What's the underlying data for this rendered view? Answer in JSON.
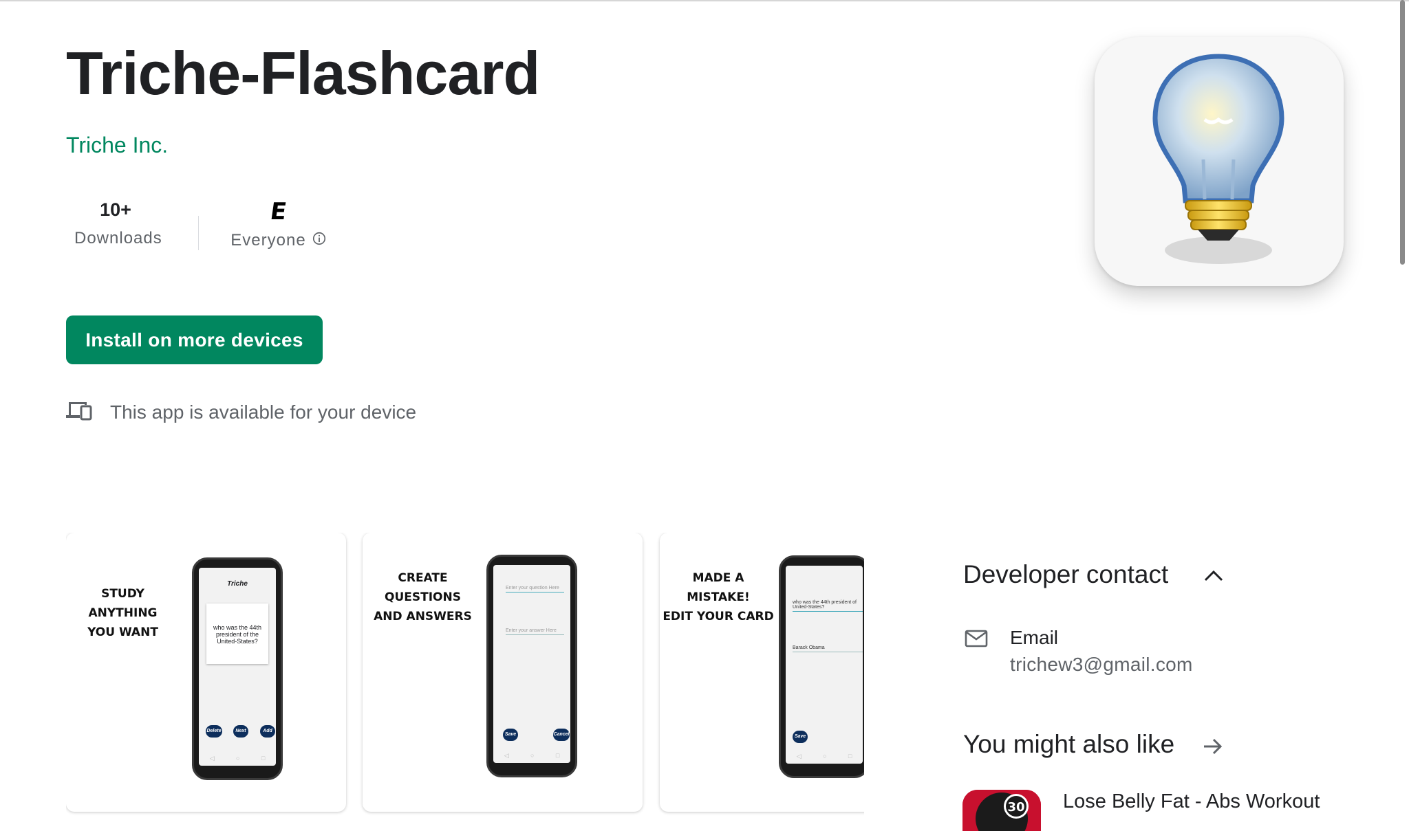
{
  "app": {
    "title": "Triche-Flashcard",
    "developer": "Triche Inc."
  },
  "stats": {
    "downloads_value": "10+",
    "downloads_label": "Downloads",
    "rating_symbol": "E",
    "rating_label": "Everyone"
  },
  "install_button": "Install on more devices",
  "device_availability": "This app is available for your device",
  "screenshots": [
    {
      "caption_line1": "STUDY ANYTHING",
      "caption_line2": "YOU WANT",
      "app_name": "Triche",
      "question": "who was the 44th president of the United-States?",
      "buttons": [
        "Delete",
        "Next",
        "Add"
      ]
    },
    {
      "caption_line1": "CREATE QUESTIONS",
      "caption_line2": "AND ANSWERS",
      "question_placeholder": "Enter your question Here",
      "answer_placeholder": "Enter your answer Here",
      "buttons": [
        "Save",
        "Cancel"
      ]
    },
    {
      "caption_line1": "MADE A MISTAKE!",
      "caption_line2": "EDIT YOUR CARD",
      "question": "who was the 44th president of United-States?",
      "answer": "Barack Obama",
      "buttons": [
        "Save"
      ]
    }
  ],
  "developer_contact": {
    "title": "Developer contact",
    "email_label": "Email",
    "email_value": "trichew3@gmail.com"
  },
  "recommendations": {
    "title": "You might also like",
    "items": [
      {
        "name": "Lose Belly Fat - Abs Workout",
        "badge": "30"
      }
    ]
  },
  "colors": {
    "brand_green": "#01875f",
    "text_primary": "#202124",
    "text_secondary": "#5f6368"
  },
  "icons": [
    "info-icon",
    "devices-icon",
    "lightbulb-icon",
    "chevron-up-icon",
    "email-icon",
    "arrow-right-icon"
  ]
}
